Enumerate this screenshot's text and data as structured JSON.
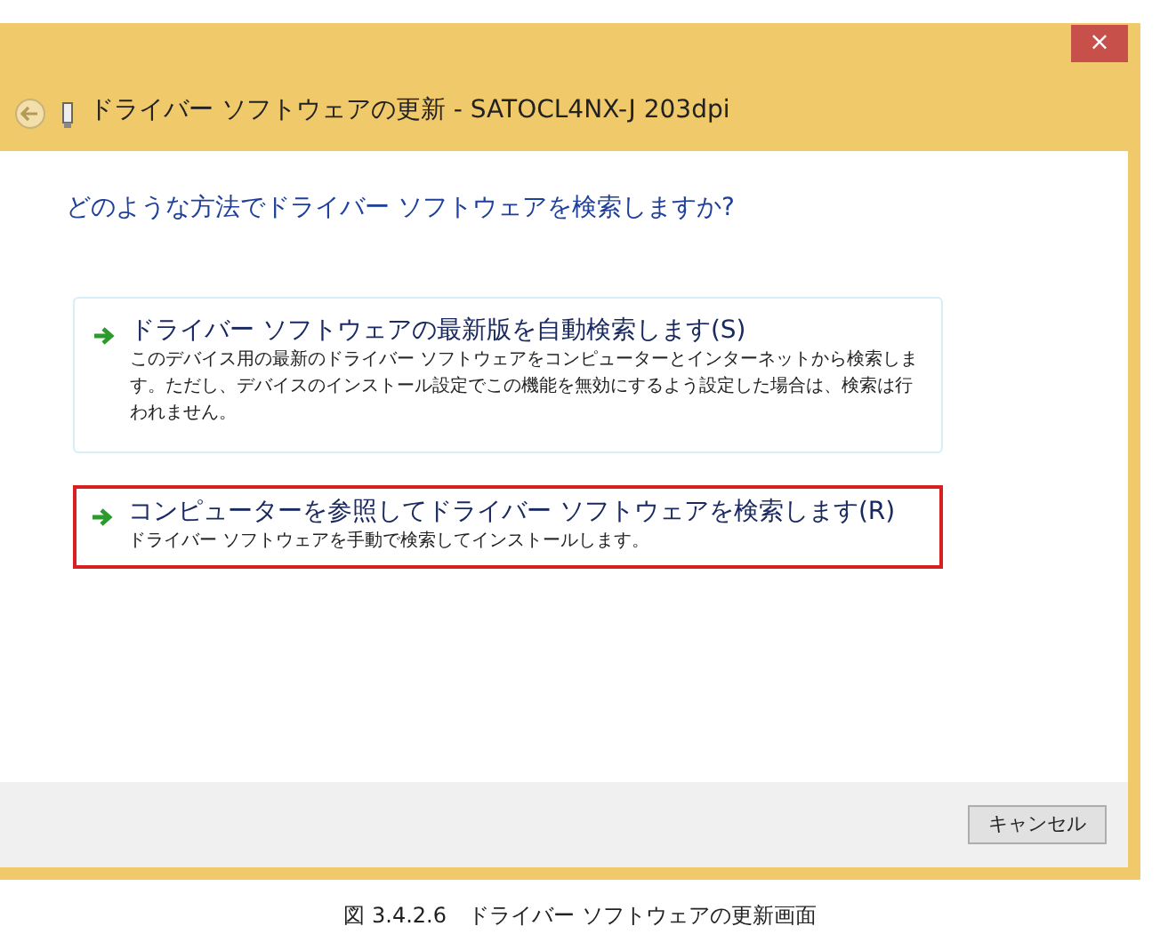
{
  "window": {
    "title": "ドライバー ソフトウェアの更新 - SATOCL4NX-J 203dpi",
    "close": "×"
  },
  "heading": "どのような方法でドライバー ソフトウェアを検索しますか?",
  "options": [
    {
      "title": "ドライバー ソフトウェアの最新版を自動検索します(S)",
      "description": "このデバイス用の最新のドライバー ソフトウェアをコンピューターとインターネットから検索します。ただし、デバイスのインストール設定でこの機能を無効にするよう設定した場合は、検索は行われません。",
      "highlighted": false
    },
    {
      "title": "コンピューターを参照してドライバー ソフトウェアを検索します(R)",
      "description": "ドライバー ソフトウェアを手動で検索してインストールします。",
      "highlighted": true
    }
  ],
  "buttons": [
    "キャンセル"
  ],
  "caption": "図 3.4.2.6　ドライバー ソフトウェアの更新画面"
}
